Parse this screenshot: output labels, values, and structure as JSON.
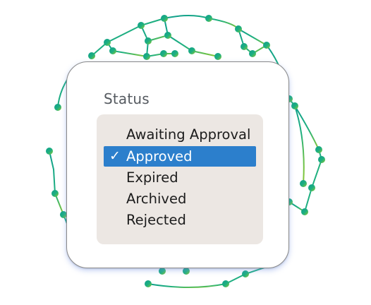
{
  "status_field": {
    "label": "Status",
    "options": [
      {
        "label": "Awaiting Approval",
        "selected": false
      },
      {
        "label": "Approved",
        "selected": true
      },
      {
        "label": "Expired",
        "selected": false
      },
      {
        "label": "Archived",
        "selected": false
      },
      {
        "label": "Rejected",
        "selected": false
      }
    ],
    "check_glyph": "✓"
  },
  "colors": {
    "selected_bg": "#2c7fcc",
    "listbox_bg": "#ece7e3",
    "network_teal": "#1aa889",
    "network_green": "#7cc83a"
  }
}
